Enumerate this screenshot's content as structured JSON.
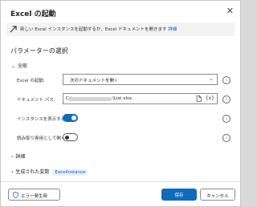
{
  "dialog": {
    "title": "Excel の起動",
    "close_icon": "close-icon"
  },
  "banner": {
    "text": "新しい Excel インスタンスを起動するか、Excel ドキュメントを開きます",
    "link": "詳細",
    "icon": "launch-icon"
  },
  "section_title": "パラメーターの選択",
  "general": {
    "header": "全般",
    "launch_label": "Excel の起動:",
    "launch_value": "次のドキュメントを開く",
    "path_label": "ドキュメント パス:",
    "path_prefix": "C:\\",
    "path_suffix": "\\List.xlsx",
    "visible_label": "インスタンスを表示する:",
    "visible_value": true,
    "readonly_label": "読み取り専用として開く:",
    "readonly_value": false
  },
  "advanced_label": "詳細",
  "variables": {
    "label": "生成された変数",
    "badge": "ExcelInstance"
  },
  "footer": {
    "error_button": "エラー発生時",
    "save_button": "保存",
    "cancel_button": "キャンセル"
  },
  "colors": {
    "accent": "#0f6cbd",
    "link": "#0b57d0"
  }
}
